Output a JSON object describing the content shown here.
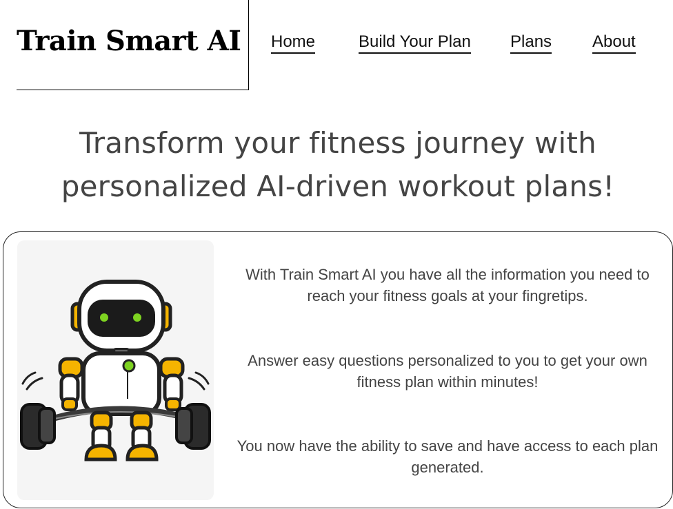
{
  "brand": {
    "title": "Train Smart AI"
  },
  "nav": {
    "items": [
      {
        "label": "Home"
      },
      {
        "label": "Build Your Plan"
      },
      {
        "label": "Plans"
      },
      {
        "label": "About"
      }
    ]
  },
  "hero": {
    "title": "Transform your fitness journey with personalized AI-driven workout plans!"
  },
  "features": {
    "paragraphs": [
      "With Train Smart AI you have all the information you need to reach your fitness goals at your fingretips.",
      "Answer easy questions personalized to you to get your own fitness plan within minutes!",
      "You now have the ability to save and have access to each plan generated."
    ],
    "image": {
      "icon": "robot-lifting-barbell-icon"
    }
  },
  "colors": {
    "text_dark": "#000000",
    "text_body": "#444444",
    "robot_accent": "#f5b400",
    "robot_eyes": "#7ed321"
  }
}
